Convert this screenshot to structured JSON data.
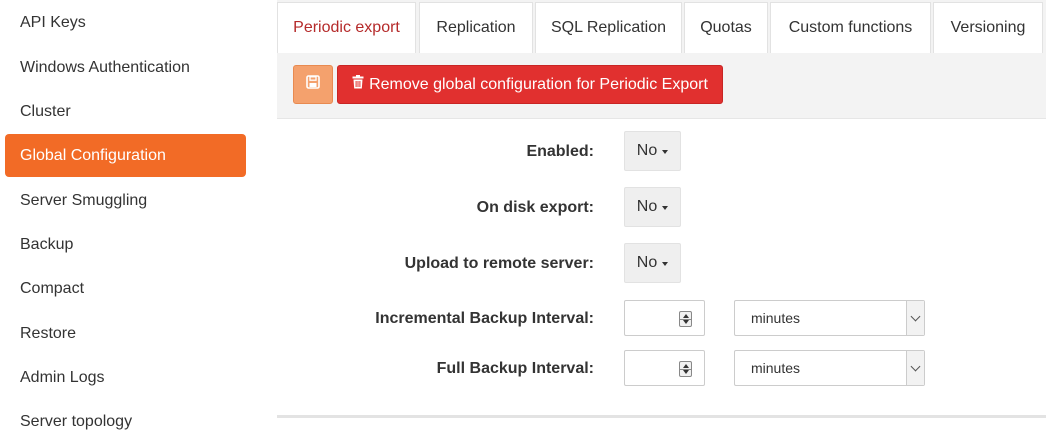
{
  "sidebar": {
    "items": [
      {
        "label": "API Keys"
      },
      {
        "label": "Windows Authentication"
      },
      {
        "label": "Cluster"
      },
      {
        "label": "Global Configuration",
        "active": true
      },
      {
        "label": "Server Smuggling"
      },
      {
        "label": "Backup"
      },
      {
        "label": "Compact"
      },
      {
        "label": "Restore"
      },
      {
        "label": "Admin Logs"
      },
      {
        "label": "Server topology"
      }
    ]
  },
  "tabs": [
    {
      "label": "Periodic export",
      "active": true
    },
    {
      "label": "Replication"
    },
    {
      "label": "SQL Replication"
    },
    {
      "label": "Quotas"
    },
    {
      "label": "Custom functions"
    },
    {
      "label": "Versioning"
    }
  ],
  "toolbar": {
    "save_icon": "floppy-disk-icon",
    "remove_icon": "trash-icon",
    "remove_label": "Remove global configuration for Periodic Export"
  },
  "form": {
    "enabled": {
      "label": "Enabled:",
      "value": "No"
    },
    "on_disk_export": {
      "label": "On disk export:",
      "value": "No"
    },
    "upload_remote": {
      "label": "Upload to remote server:",
      "value": "No"
    },
    "incremental_interval": {
      "label": "Incremental Backup Interval:",
      "value": "",
      "unit": "minutes"
    },
    "full_interval": {
      "label": "Full Backup Interval:",
      "value": "",
      "unit": "minutes"
    }
  },
  "colors": {
    "accent": "#f26b26",
    "danger": "#e1302f",
    "active_tab_text": "#b52a2a"
  }
}
